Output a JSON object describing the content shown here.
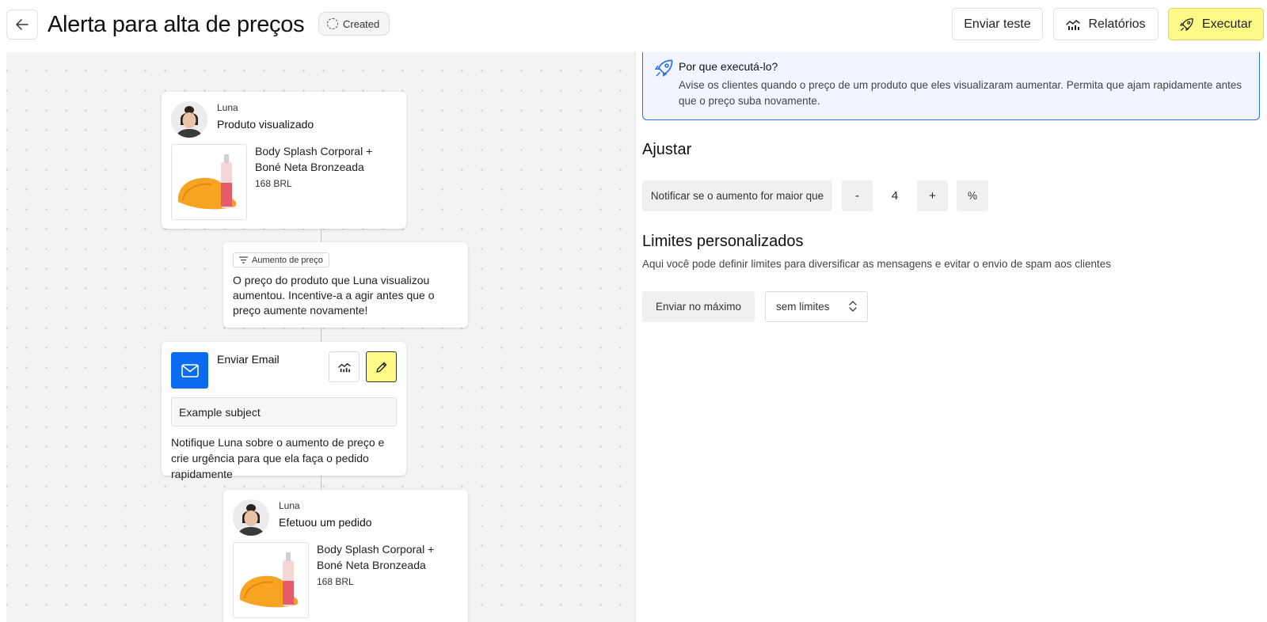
{
  "header": {
    "title": "Alerta para alta de preços",
    "status": "Created",
    "buttons": {
      "test": "Enviar teste",
      "reports": "Relatórios",
      "run": "Executar"
    }
  },
  "flow": {
    "trigger": {
      "customer": "Luna",
      "event": "Produto visualizado",
      "product_name": "Body Splash Corporal + Boné Neta Bronzeada",
      "product_price": "168 BRL"
    },
    "filter": {
      "chip": "Aumento de preço",
      "text": "O preço do produto que Luna visualizou aumentou. Incentive-a a agir antes que o preço aumente novamente!"
    },
    "email": {
      "title": "Enviar Email",
      "subject": "Example subject",
      "description": "Notifique Luna sobre o aumento de preço e crie urgência para que ela faça o pedido rapidamente"
    },
    "order": {
      "customer": "Luna",
      "event": "Efetuou um pedido",
      "product_name": "Body Splash Corporal + Boné Neta Bronzeada",
      "product_price": "168 BRL"
    }
  },
  "panel": {
    "why": {
      "title": "Por que executá-lo?",
      "text": "Avise os clientes quando o preço de um produto que eles visualizaram aumentar. Permita que ajam rapidamente antes que o preço suba novamente."
    },
    "adjust": {
      "title": "Ajustar",
      "label": "Notificar se o aumento for maior que",
      "minus": "-",
      "value": "4",
      "plus": "+",
      "unit": "%"
    },
    "limits": {
      "title": "Limites personalizados",
      "subtitle": "Aqui você pode definir limites para diversificar as mensagens e evitar o envio de spam aos clientes",
      "label": "Enviar no máximo",
      "selected": "sem limites"
    }
  },
  "colors": {
    "accent_yellow": "#fdfa87",
    "email_blue": "#0b6cf2",
    "info_border": "#2f6fe8",
    "info_bg": "#f1f5ff"
  },
  "icons": {
    "back": "arrow-left-icon",
    "status": "dashed-circle-icon",
    "reports": "chart-icon",
    "run": "rocket-icon",
    "filter": "filter-icon",
    "email": "mail-icon",
    "edit": "pencil-icon",
    "select": "chevron-up-down-icon"
  }
}
